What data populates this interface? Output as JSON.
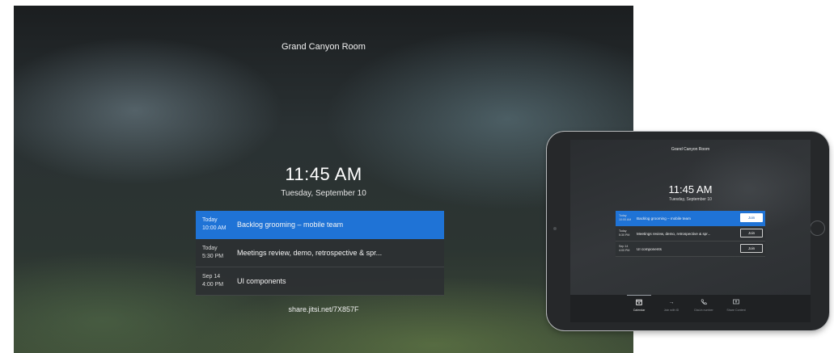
{
  "tv": {
    "room_name": "Grand Canyon Room",
    "time": "11:45 AM",
    "date": "Tuesday, September 10",
    "meetings": [
      {
        "day": "Today",
        "time": "10:00 AM",
        "title": "Backlog grooming – mobile team",
        "active": true
      },
      {
        "day": "Today",
        "time": "5:30 PM",
        "title": "Meetings review, demo, retrospective & spr...",
        "active": false
      },
      {
        "day": "Sep 14",
        "time": "4:00 PM",
        "title": "UI components",
        "active": false
      }
    ],
    "share_link": "share.jitsi.net/7X857F",
    "colors": {
      "accent": "#1f73d6"
    }
  },
  "ipad": {
    "room_name": "Grand Canyon Room",
    "time": "11:45 AM",
    "date": "Tuesday, September 10",
    "meetings": [
      {
        "day": "Today",
        "time": "10:00 AM",
        "title": "Backlog grooming – mobile team",
        "join_label": "Join",
        "active": true
      },
      {
        "day": "Today",
        "time": "5:30 PM",
        "title": "Meetings review, demo, retrospective & spr...",
        "join_label": "Join",
        "active": false
      },
      {
        "day": "Sep 14",
        "time": "4:00 PM",
        "title": "UI components",
        "join_label": "Join",
        "active": false
      }
    ],
    "nav": [
      {
        "label": "Calendar",
        "icon": "calendar-icon",
        "active": true
      },
      {
        "label": "Join with ID",
        "icon": "arrow-right-icon",
        "active": false
      },
      {
        "label": "Dial-in number",
        "icon": "phone-icon",
        "active": false
      },
      {
        "label": "Share Content",
        "icon": "share-screen-icon",
        "active": false
      }
    ]
  }
}
